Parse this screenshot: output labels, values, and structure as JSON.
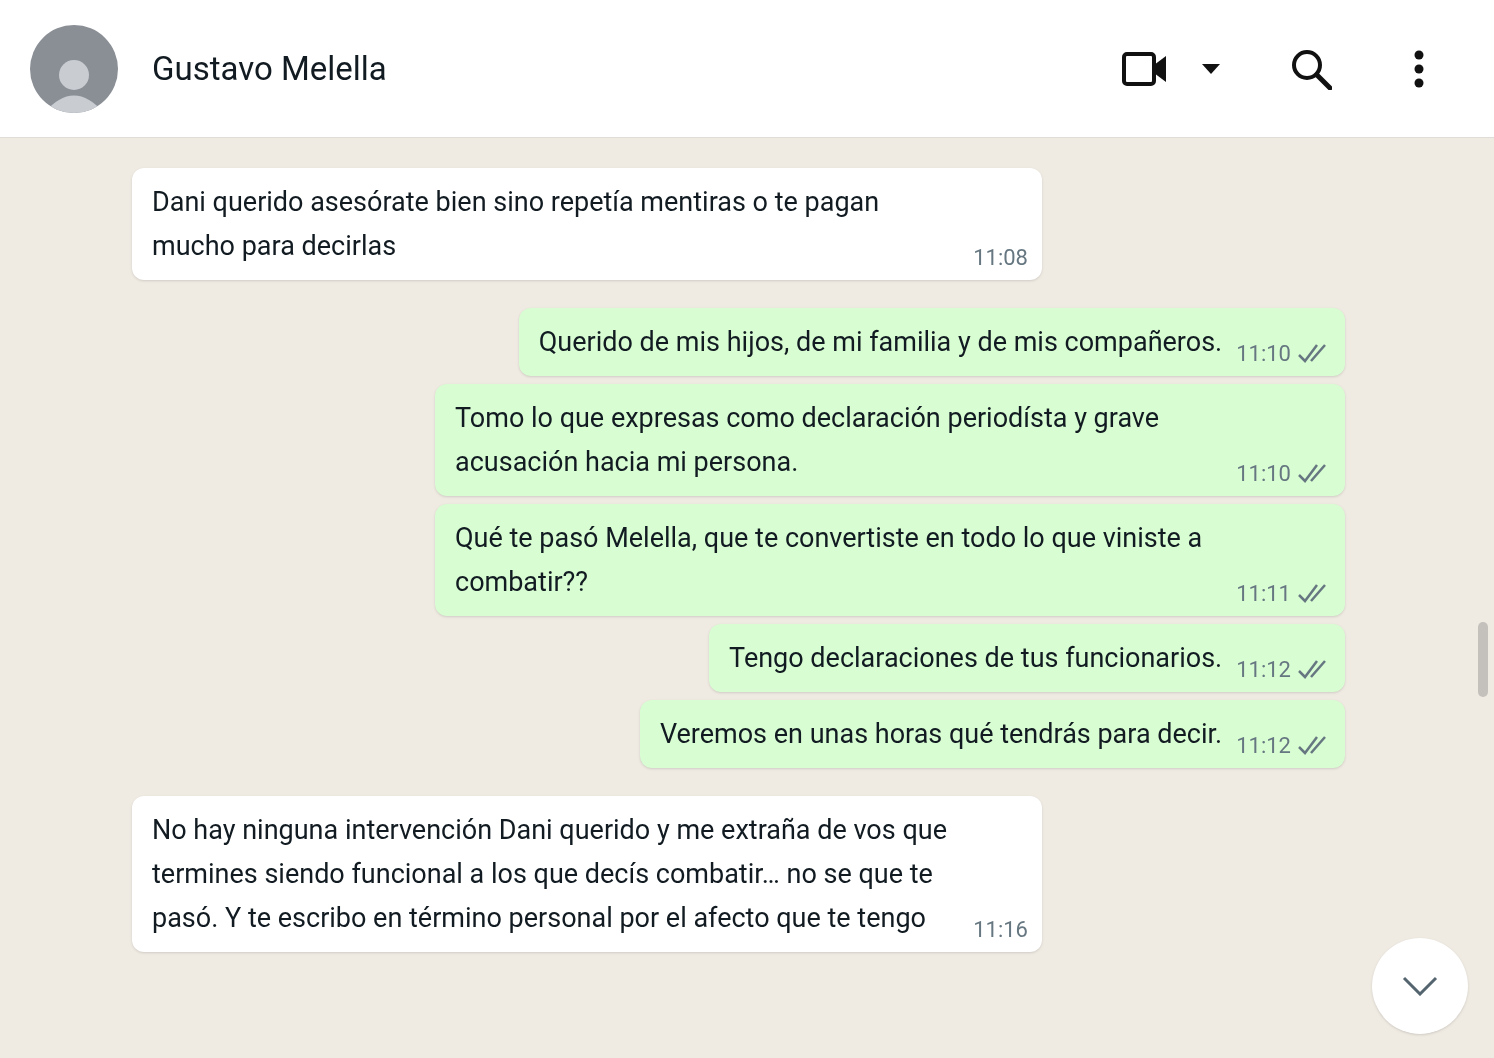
{
  "header": {
    "contact_name": "Gustavo Melella"
  },
  "messages": [
    {
      "outgoing": false,
      "text": "Dani querido asesórate bien sino repetía mentiras o te pagan mucho para decirlas",
      "time": "11:08"
    },
    {
      "outgoing": true,
      "text": "Querido de mis hijos, de mi familia y de mis compañeros.",
      "time": "11:10",
      "read": false
    },
    {
      "outgoing": true,
      "text": "Tomo lo que expresas como declaración periodísta y grave acusación hacia mi persona.",
      "time": "11:10",
      "read": false
    },
    {
      "outgoing": true,
      "text": "Qué te pasó Melella, que te convertiste en todo lo que viniste a combatir??",
      "time": "11:11",
      "read": false
    },
    {
      "outgoing": true,
      "text": "Tengo declaraciones de tus funcionarios.",
      "time": "11:12",
      "read": false
    },
    {
      "outgoing": true,
      "text": "Veremos en unas horas qué tendrás para decir.",
      "time": "11:12",
      "read": false
    },
    {
      "outgoing": false,
      "text": "No hay ninguna intervención Dani querido y me extraña de vos que termines siendo funcional a los que decís combatir… no se que te pasó. Y te escribo en término personal por el afecto que te tengo",
      "time": "11:16"
    }
  ]
}
